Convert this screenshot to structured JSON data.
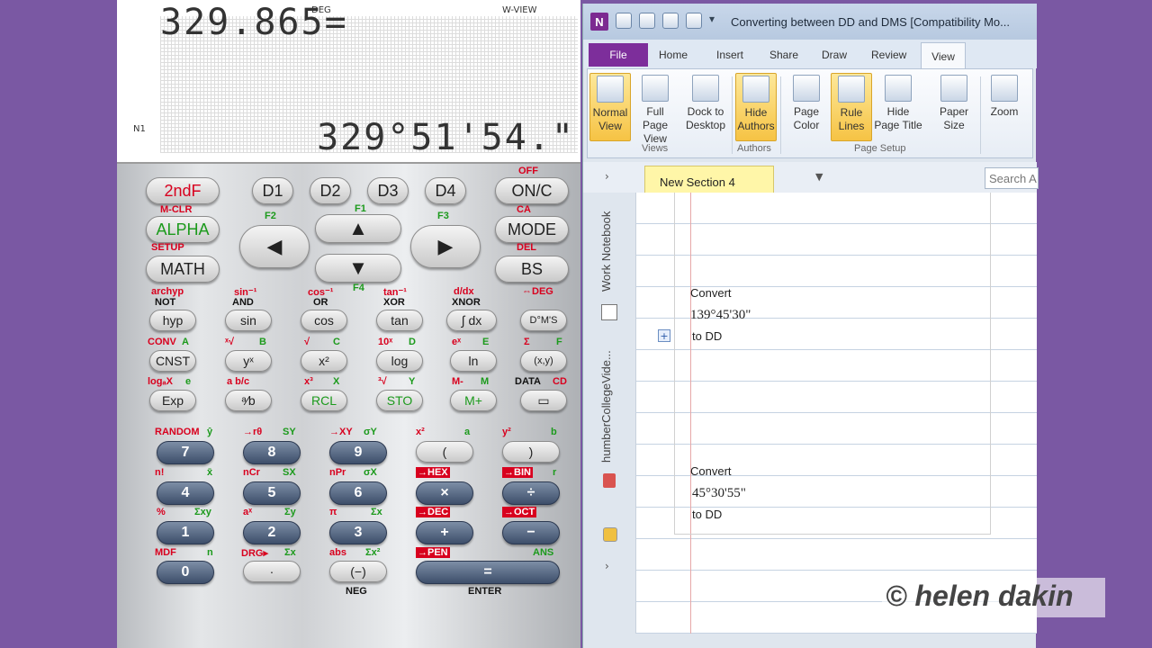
{
  "calculator": {
    "lcd": {
      "indicator_deg": "DEG",
      "indicator_wview": "W-VIEW",
      "indicator_n1": "N1",
      "top_line": "329.865=",
      "bottom_line": "329°51'54.\""
    },
    "keys": {
      "2ndf": "2ndF",
      "alpha": "ALPHA",
      "math": "MATH",
      "d1": "D1",
      "d2": "D2",
      "d3": "D3",
      "d4": "D4",
      "on_c": "ON/C",
      "mode": "MODE",
      "bs": "BS",
      "hyp": "hyp",
      "sin": "sin",
      "cos": "cos",
      "tan": "tan",
      "integral": "∫ dx",
      "dms": "D°M'S",
      "cnst": "CNST",
      "yx": "yˣ",
      "x2": "x²",
      "log": "log",
      "ln": "ln",
      "paren_xy": "(x,y)",
      "exp": "Exp",
      "frac": "ᵃ⁄b",
      "rcl": "RCL",
      "sto": "STO",
      "mplus": "M+",
      "data": "▭",
      "n7": "7",
      "n8": "8",
      "n9": "9",
      "lparen": "(",
      "rparen": ")",
      "n4": "4",
      "n5": "5",
      "n6": "6",
      "mul": "×",
      "div": "÷",
      "n1": "1",
      "n2": "2",
      "n3": "3",
      "plus": "+",
      "minus": "−",
      "n0": "0",
      "dot": "·",
      "neg": "(−)",
      "equals": "="
    },
    "labels": {
      "off": "OFF",
      "mclr": "M-CLR",
      "setup": "SETUP",
      "ca": "CA",
      "del": "DEL",
      "f1": "F1",
      "f2": "F2",
      "f3": "F3",
      "f4": "F4",
      "archyp": "archyp",
      "not": "NOT",
      "sinm1": "sin⁻¹",
      "and": "AND",
      "cosm1": "cos⁻¹",
      "or": "OR",
      "tanm1": "tan⁻¹",
      "xor": "XOR",
      "dxdx": "d/dx",
      "xnor": "XNOR",
      "todeg": "⇔DEG",
      "conv": "CONV",
      "a": "A",
      "xroot": "ˣ√",
      "b": "B",
      "sqrt": "√",
      "c": "C",
      "tenx": "10ˣ",
      "d": "D",
      "ex": "eˣ",
      "e": "E",
      "sigma": "Σ",
      "f": "F",
      "logax": "logₐX",
      "ee": "e",
      "abc": "a b/c",
      "x3": "x³",
      "xx": "X",
      "cbrt": "³√",
      "y": "Y",
      "mminus": "M-",
      "m": "M",
      "data_lbl": "DATA",
      "cd": "CD",
      "random": "RANDOM",
      "yhat": "ŷ",
      "topolar": "→rθ",
      "sy": "SY",
      "toxy": "→XY",
      "sigy": "σY",
      "xsq": "x²",
      "a2": "a",
      "ysq": "y²",
      "b2": "b",
      "nfact": "n!",
      "xbar": "x̄",
      "ncr": "nCr",
      "sx": "SX",
      "npr": "nPr",
      "sigx": "σX",
      "tohex": "→HEX",
      "tobin": "→BIN",
      "r": "r",
      "pct": "%",
      "sxy": "Σxy",
      "ax": "aˣ",
      "sy2": "Σy",
      "pi": "π",
      "sx2": "Σx",
      "todec": "→DEC",
      "tooct": "→OCT",
      "mdf": "MDF",
      "n": "n",
      "drg": "DRG▸",
      "sumx": "Σx",
      "abs": "abs",
      "sumx2": "Σx²",
      "topen": "→PEN",
      "ans": "ANS",
      "neg_lbl": "NEG",
      "enter": "ENTER"
    }
  },
  "onenote": {
    "title": "Converting between DD and DMS [Compatibility Mo...",
    "logo": "N",
    "tabs": [
      "File",
      "Home",
      "Insert",
      "Share",
      "Draw",
      "Review",
      "View"
    ],
    "ribbon": {
      "normal_view": "Normal View",
      "full_page_view": "Full Page View",
      "dock_to_desktop": "Dock to Desktop",
      "hide_authors": "Hide Authors",
      "page_color": "Page Color",
      "rule_lines": "Rule Lines",
      "hide_page_title": "Hide Page Title",
      "paper_size": "Paper Size",
      "zoom": "Zoom",
      "group_views": "Views",
      "group_authors": "Authors",
      "group_page_setup": "Page Setup"
    },
    "section_tab": "New Section 4",
    "search_placeholder": "Search A",
    "sidebar": {
      "notebook1": "Work Notebook",
      "notebook2": "humberCollegeVide..."
    },
    "note": {
      "convert1": "Convert",
      "value1": "139°45'30\"",
      "to_dd1": "to DD",
      "convert2": "Convert",
      "value2": "45°30'55\"",
      "to_dd2": "to DD"
    }
  },
  "watermark": "© helen dakin"
}
